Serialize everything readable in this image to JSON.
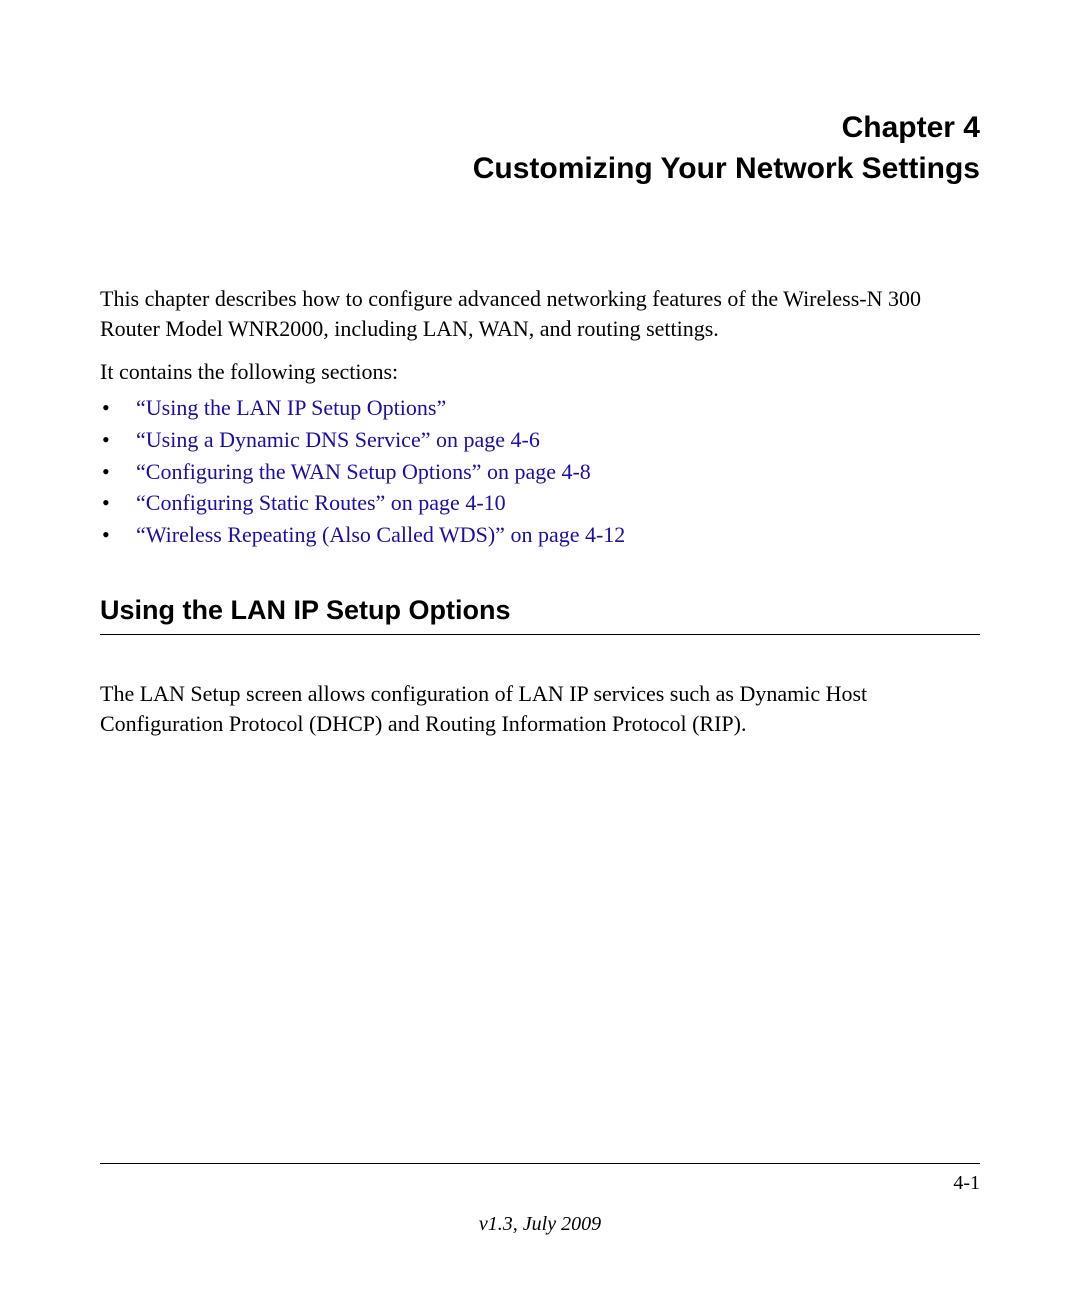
{
  "header": {
    "chapter_line": "Chapter 4",
    "title_line": "Customizing Your Network Settings"
  },
  "intro": "This chapter describes how to configure advanced networking features of the Wireless-N 300 Router Model WNR2000, including LAN, WAN, and routing settings.",
  "sections_label": "It contains the following sections:",
  "toc": [
    {
      "label": "“Using the LAN IP Setup Options”"
    },
    {
      "label": "“Using a Dynamic DNS Service” on page 4-6"
    },
    {
      "label": "“Configuring the WAN Setup Options” on page 4-8"
    },
    {
      "label": "“Configuring Static Routes” on page 4-10"
    },
    {
      "label": "“Wireless Repeating (Also Called WDS)” on page 4-12"
    }
  ],
  "section": {
    "heading": "Using the LAN IP Setup Options",
    "body": "The LAN Setup screen allows configuration of LAN IP services such as Dynamic Host Configuration Protocol (DHCP) and Routing Information Protocol (RIP)."
  },
  "footer": {
    "page_number": "4-1",
    "version": "v1.3, July 2009"
  }
}
